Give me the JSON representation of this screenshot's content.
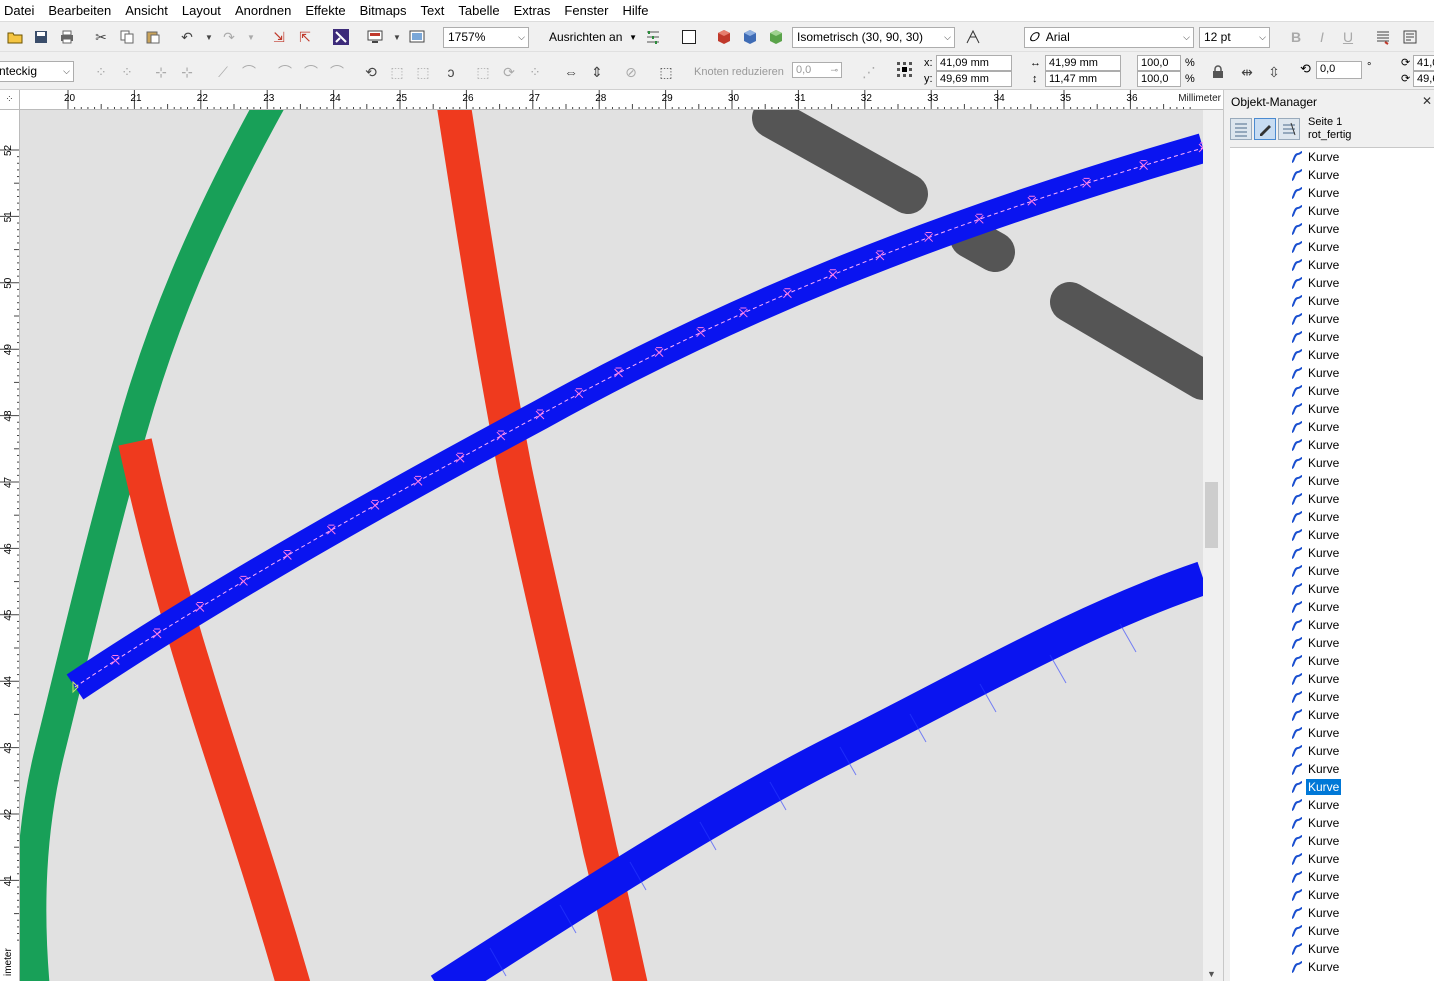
{
  "menu": [
    "Datei",
    "Bearbeiten",
    "Ansicht",
    "Layout",
    "Anordnen",
    "Effekte",
    "Bitmaps",
    "Text",
    "Tabelle",
    "Extras",
    "Fenster",
    "Hilfe"
  ],
  "toolbar": {
    "zoom_value": "1757%",
    "snap_label": "Ausrichten an",
    "extrude_preset": "Isometrisch (30, 90, 30)",
    "font_name": "Arial",
    "font_size": "12 pt"
  },
  "property_bar": {
    "shape_mode": "nteckig",
    "reduce_nodes_label": "Knoten reduzieren",
    "reduce_nodes_value": "0,0",
    "x_label": "x:",
    "x_value": "41,09 mm",
    "y_label": "y:",
    "y_value": "49,69 mm",
    "width_value": "41,99 mm",
    "height_value": "11,47 mm",
    "scale_x": "100,0",
    "scale_y": "100,0",
    "percent": "%",
    "rotation_value": "0,0",
    "degree": "°",
    "partial_right_1": "41,0",
    "partial_right_2": "49,6"
  },
  "ruler": {
    "h_ticks": [
      "20",
      "21",
      "22",
      "23",
      "24",
      "25",
      "26",
      "27",
      "28",
      "29",
      "30",
      "31",
      "32",
      "33",
      "34",
      "35",
      "36"
    ],
    "unit": "Millimeter",
    "v_ticks": [
      "52",
      "51",
      "50",
      "49",
      "48",
      "47",
      "46",
      "45",
      "44",
      "43",
      "42",
      "41"
    ],
    "v_unit": "imeter"
  },
  "object_manager": {
    "title": "Objekt-Manager",
    "page": "Seite 1",
    "layer": "rot_fertig",
    "items": [
      "Kurve",
      "Kurve",
      "Kurve",
      "Kurve",
      "Kurve",
      "Kurve",
      "Kurve",
      "Kurve",
      "Kurve",
      "Kurve",
      "Kurve",
      "Kurve",
      "Kurve",
      "Kurve",
      "Kurve",
      "Kurve",
      "Kurve",
      "Kurve",
      "Kurve",
      "Kurve",
      "Kurve",
      "Kurve",
      "Kurve",
      "Kurve",
      "Kurve",
      "Kurve",
      "Kurve",
      "Kurve",
      "Kurve",
      "Kurve",
      "Kurve",
      "Kurve",
      "Kurve",
      "Kurve",
      "Kurve",
      "Kurve",
      "Kurve",
      "Kurve",
      "Kurve",
      "Kurve",
      "Kurve",
      "Kurve",
      "Kurve",
      "Kurve",
      "Kurve",
      "Kurve"
    ],
    "selected_index": 35
  },
  "colors": {
    "green": "#18a058",
    "red": "#ef3a1e",
    "blue": "#0a14f0",
    "gray": "#555555",
    "selection": "#0078d7"
  }
}
